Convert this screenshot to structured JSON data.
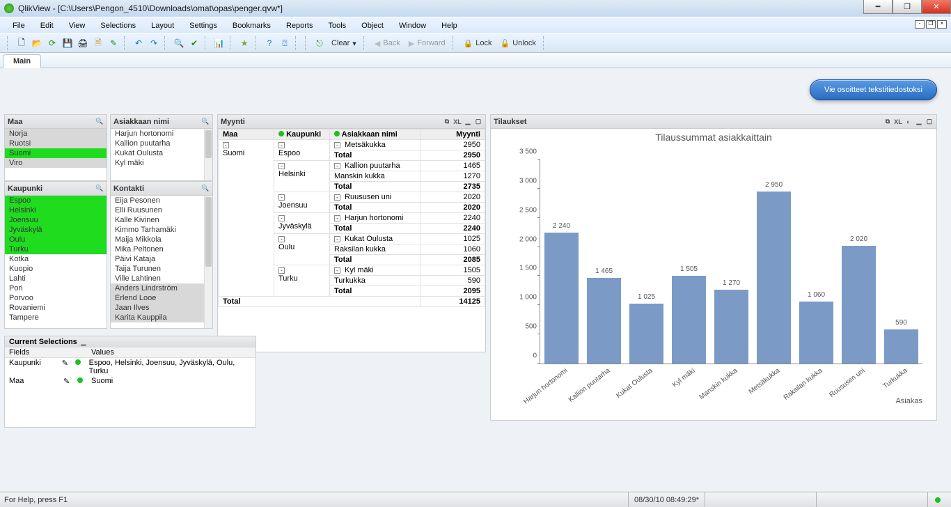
{
  "app_title": "QlikView - [C:\\Users\\Pengon_4510\\Downloads\\omat\\opas\\penger.qvw*]",
  "menus": [
    "File",
    "Edit",
    "View",
    "Selections",
    "Layout",
    "Settings",
    "Bookmarks",
    "Reports",
    "Tools",
    "Object",
    "Window",
    "Help"
  ],
  "toolbar": {
    "clear": "Clear",
    "back": "Back",
    "forward": "Forward",
    "lock": "Lock",
    "unlock": "Unlock"
  },
  "tab": "Main",
  "export_button": "Vie osoitteet tekstitiedostoksi",
  "listboxes": {
    "maa": {
      "title": "Maa",
      "items": [
        {
          "label": "Norja",
          "sel": false,
          "gray": true
        },
        {
          "label": "Ruotsi",
          "sel": false,
          "gray": true
        },
        {
          "label": "Suomi",
          "sel": true
        },
        {
          "label": "Viro",
          "sel": false,
          "gray": true
        }
      ]
    },
    "kaupunki": {
      "title": "Kaupunki",
      "items": [
        {
          "label": "Espoo",
          "sel": true
        },
        {
          "label": "Helsinki",
          "sel": true
        },
        {
          "label": "Joensuu",
          "sel": true
        },
        {
          "label": "Jyväskylä",
          "sel": true
        },
        {
          "label": "Oulu",
          "sel": true
        },
        {
          "label": "Turku",
          "sel": true
        },
        {
          "label": "Kotka",
          "sel": false
        },
        {
          "label": "Kuopio",
          "sel": false
        },
        {
          "label": "Lahti",
          "sel": false
        },
        {
          "label": "Pori",
          "sel": false
        },
        {
          "label": "Porvoo",
          "sel": false
        },
        {
          "label": "Rovaniemi",
          "sel": false
        },
        {
          "label": "Tampere",
          "sel": false
        }
      ]
    },
    "asiakas": {
      "title": "Asiakkaan nimi",
      "items": [
        {
          "label": "Harjun hortonomi"
        },
        {
          "label": "Kallion puutarha"
        },
        {
          "label": "Kukat Oulusta"
        },
        {
          "label": "Kyl mäki"
        }
      ]
    },
    "kontakti": {
      "title": "Kontakti",
      "items": [
        {
          "label": "Eija Pesonen"
        },
        {
          "label": "Elli Ruusunen"
        },
        {
          "label": "Kalle Kivinen"
        },
        {
          "label": "Kimmo Tarhamäki"
        },
        {
          "label": "Maija Mikkola"
        },
        {
          "label": "Mika Peltonen"
        },
        {
          "label": "Päivi Kataja"
        },
        {
          "label": "Taija Turunen"
        },
        {
          "label": "Ville Lahtinen"
        },
        {
          "label": "Anders Lindrström",
          "gray": true
        },
        {
          "label": "Erlend Looe",
          "gray": true
        },
        {
          "label": "Jaan Ilves",
          "gray": true
        },
        {
          "label": "Karita Kauppila",
          "gray": true
        }
      ]
    }
  },
  "pivot": {
    "title": "Myynti",
    "cols": [
      "Maa",
      "Kaupunki",
      "Asiakkaan nimi",
      "Myynti"
    ],
    "maa": "Suomi",
    "rows": [
      {
        "city": "Espoo",
        "items": [
          [
            "Metsäkukka",
            "2950"
          ]
        ],
        "total": "2950"
      },
      {
        "city": "Helsinki",
        "items": [
          [
            "Kallion puutarha",
            "1465"
          ],
          [
            "Manskin kukka",
            "1270"
          ]
        ],
        "total": "2735"
      },
      {
        "city": "Joensuu",
        "items": [
          [
            "Ruususen uni",
            "2020"
          ]
        ],
        "total": "2020"
      },
      {
        "city": "Jyväskylä",
        "items": [
          [
            "Harjun hortonomi",
            "2240"
          ]
        ],
        "total": "2240"
      },
      {
        "city": "Oulu",
        "items": [
          [
            "Kukat Oulusta",
            "1025"
          ],
          [
            "Raksilan kukka",
            "1060"
          ]
        ],
        "total": "2085"
      },
      {
        "city": "Turku",
        "items": [
          [
            "Kyl mäki",
            "1505"
          ],
          [
            "Turkukka",
            "590"
          ]
        ],
        "total": "2095"
      }
    ],
    "total_label": "Total",
    "grand_total": "14125"
  },
  "chart_data": {
    "type": "bar",
    "panel_title": "Tilaukset",
    "title": "Tilaussummat asiakkaittain",
    "categories": [
      "Harjun hortonomi",
      "Kallion puutarha",
      "Kukat Oulusta",
      "Kyl mäki",
      "Manskin kukka",
      "Metsäkukka",
      "Raksilan kukka",
      "Ruususen uni",
      "Turkukka"
    ],
    "values": [
      2240,
      1465,
      1025,
      1505,
      1270,
      2950,
      1060,
      2020,
      590
    ],
    "value_labels": [
      "2 240",
      "1 465",
      "1 025",
      "1 505",
      "1 270",
      "2 950",
      "1 060",
      "2 020",
      "590"
    ],
    "yticks": [
      0,
      500,
      1000,
      1500,
      2000,
      2500,
      3000,
      3500
    ],
    "ytick_labels": [
      "0",
      "500",
      "1 000",
      "1 500",
      "2 000",
      "2 500",
      "3 000",
      "3 500"
    ],
    "xlabel": "Asiakas",
    "ymax": 3500
  },
  "current_selections": {
    "title": "Current Selections",
    "cols": [
      "Fields",
      "Values"
    ],
    "rows": [
      {
        "field": "Kaupunki",
        "value": "Espoo, Helsinki, Joensuu, Jyväskylä, Oulu, Turku"
      },
      {
        "field": "Maa",
        "value": "Suomi"
      }
    ]
  },
  "status": {
    "help": "For Help, press F1",
    "time": "08/30/10 08:49:29*"
  }
}
